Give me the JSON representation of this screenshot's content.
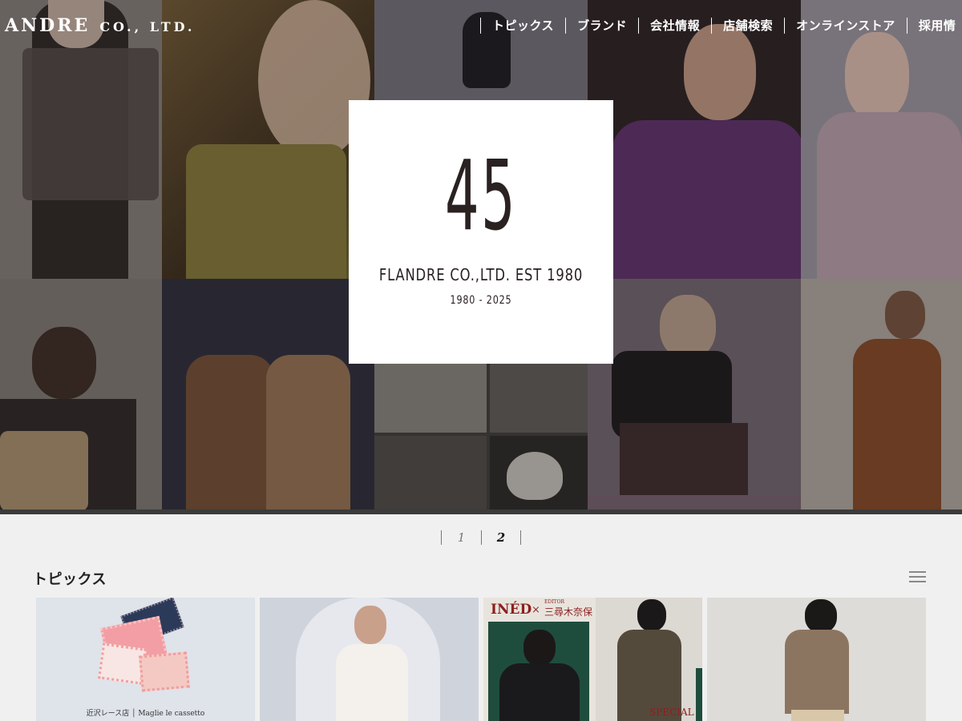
{
  "header": {
    "logo_main": "ANDRE",
    "logo_sub": "CO., LTD.",
    "nav": [
      {
        "label": "トピックス"
      },
      {
        "label": "ブランド"
      },
      {
        "label": "会社情報"
      },
      {
        "label": "店舗検索"
      },
      {
        "label": "オンラインストア"
      },
      {
        "label": "採用情"
      }
    ]
  },
  "hero": {
    "anniversary_number": "45",
    "est_line": "FLANDRE CO.,LTD.  EST 1980",
    "years": "1980 - 2025"
  },
  "pager": {
    "pages": [
      "1",
      "2"
    ],
    "active": "2"
  },
  "topics": {
    "title": "トピックス",
    "cards": [
      {
        "caption": "近沢レース店 │ Maglie le cassetto"
      },
      {
        "caption": ""
      },
      {
        "brand": "INÉD",
        "cross": "×",
        "editor_label": "EDITOR",
        "editor_name": "三尋木奈保",
        "badge": "SPECIAL"
      },
      {
        "caption": ""
      }
    ]
  },
  "colors": {
    "accent_dark": "#2a2121",
    "page_bg": "#f0f0f0",
    "card_bg": "#ffffff"
  },
  "icons": {
    "menu": "hamburger-menu-icon"
  }
}
